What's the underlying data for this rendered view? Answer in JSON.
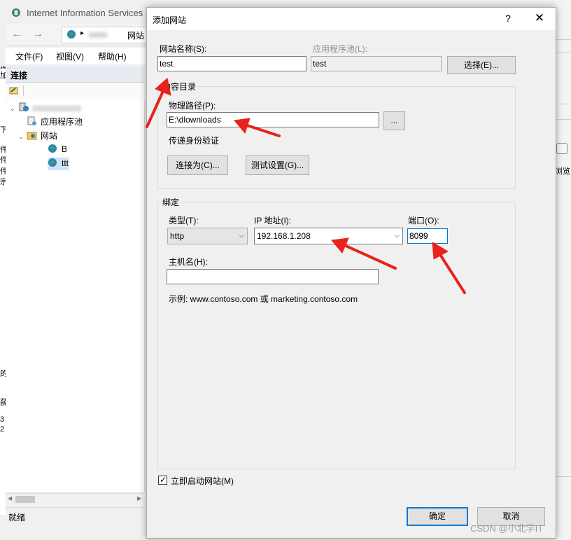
{
  "background_app": {
    "title": "Internet Information Services",
    "breadcrumb_tail": "网站",
    "menu": [
      "文件(F)",
      "视图(V)",
      "帮助(H)"
    ],
    "connections_header": "连接",
    "tree": {
      "app_pools": "应用程序池",
      "sites": "网站",
      "site_b": "B",
      "site_ttt": "ttt"
    },
    "status": "就绪",
    "left_edge_fragments": [
      "藏",
      "加",
      "下",
      "件",
      "件",
      "件",
      "宗",
      "的",
      "",
      "薛",
      "3",
      "2"
    ],
    "right_action_label": "浏览"
  },
  "dialog": {
    "title": "添加网站",
    "help_glyph": "?",
    "close_glyph": "✕",
    "site_name": {
      "label": "网站名称(S):",
      "value": "test"
    },
    "app_pool": {
      "label": "应用程序池(L):",
      "value": "test",
      "select_button": "选择(E)..."
    },
    "content_dir": {
      "group_title": "内容目录",
      "physical_path_label": "物理路径(P):",
      "physical_path_value": "E:\\dlownloads",
      "browse_button": "...",
      "pass_through_auth": "传递身份验证",
      "connect_as_button": "连接为(C)...",
      "test_settings_button": "测试设置(G)..."
    },
    "binding": {
      "group_title": "绑定",
      "type_label": "类型(T):",
      "type_value": "http",
      "ip_label": "IP 地址(I):",
      "ip_value": "192.168.1.208",
      "port_label": "端口(O):",
      "port_value": "8099",
      "hostname_label": "主机名(H):",
      "hostname_value": "",
      "example": "示例: www.contoso.com 或 marketing.contoso.com"
    },
    "start_immediately": {
      "label": "立即启动网站(M)",
      "checked": true
    },
    "ok_button": "确定",
    "cancel_button": "取消"
  },
  "watermark": "CSDN @小北学IT",
  "colors": {
    "annotation_arrow": "#e8231b",
    "focus_blue": "#0078d7"
  }
}
